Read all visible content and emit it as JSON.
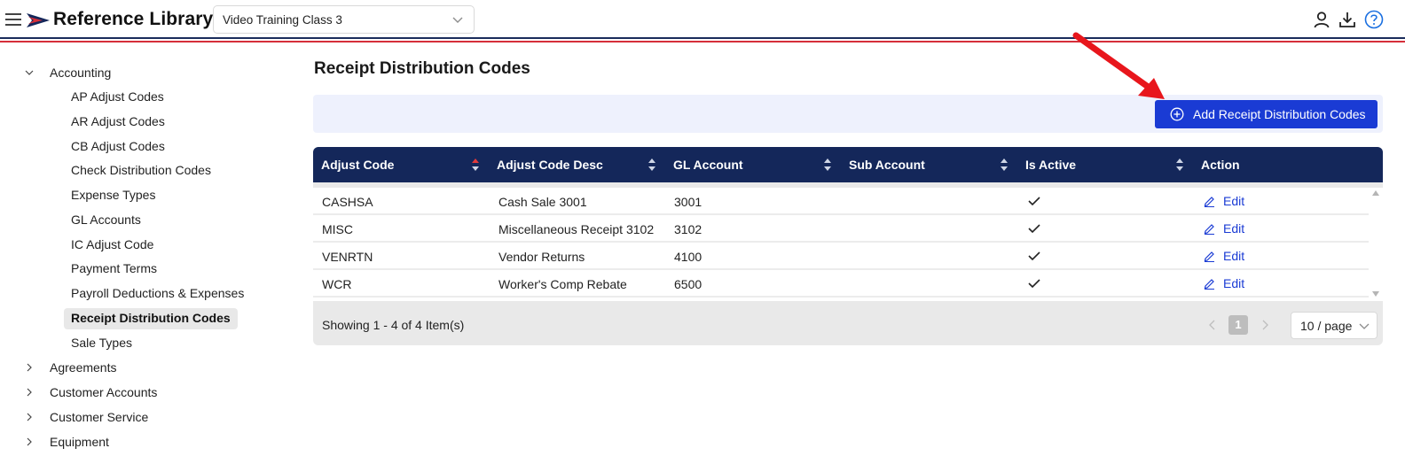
{
  "header": {
    "app_title": "Reference Library",
    "class_select": {
      "value": "Video Training Class 3"
    },
    "icons": [
      "user-icon",
      "download-icon",
      "help-icon"
    ]
  },
  "sidebar": {
    "groups": [
      {
        "label": "Accounting",
        "expanded": true,
        "items": [
          "AP Adjust Codes",
          "AR Adjust Codes",
          "CB Adjust Codes",
          "Check Distribution Codes",
          "Expense Types",
          "GL Accounts",
          "IC Adjust Code",
          "Payment Terms",
          "Payroll Deductions & Expenses",
          "Receipt Distribution Codes",
          "Sale Types"
        ],
        "active_item": "Receipt Distribution Codes"
      },
      {
        "label": "Agreements",
        "expanded": false
      },
      {
        "label": "Customer Accounts",
        "expanded": false
      },
      {
        "label": "Customer Service",
        "expanded": false
      },
      {
        "label": "Equipment",
        "expanded": false
      }
    ]
  },
  "main": {
    "page_title": "Receipt Distribution Codes",
    "add_button": "Add Receipt Distribution Codes",
    "table": {
      "columns": [
        "Adjust Code",
        "Adjust Code Desc",
        "GL Account",
        "Sub Account",
        "Is Active",
        "Action"
      ],
      "rows": [
        {
          "adjust_code": "CASHSA",
          "desc": "Cash Sale 3001",
          "gl_account": "3001",
          "sub_account": "",
          "is_active": true,
          "action": "Edit"
        },
        {
          "adjust_code": "MISC",
          "desc": "Miscellaneous Receipt 3102",
          "gl_account": "3102",
          "sub_account": "",
          "is_active": true,
          "action": "Edit"
        },
        {
          "adjust_code": "VENRTN",
          "desc": "Vendor Returns",
          "gl_account": "4100",
          "sub_account": "",
          "is_active": true,
          "action": "Edit"
        },
        {
          "adjust_code": "WCR",
          "desc": "Worker's Comp Rebate",
          "gl_account": "6500",
          "sub_account": "",
          "is_active": true,
          "action": "Edit"
        }
      ]
    },
    "pagination": {
      "info": "Showing 1 - 4 of 4 Item(s)",
      "current_page": "1",
      "page_size": "10 / page"
    }
  },
  "colors": {
    "brand_navy": "#14275a",
    "brand_red": "#d62f3a",
    "accent_blue": "#1a3bd4",
    "annotation_red": "#e8161c"
  }
}
